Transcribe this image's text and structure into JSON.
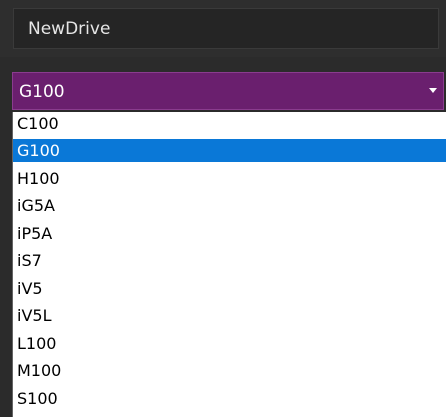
{
  "title_field": {
    "value": "NewDrive"
  },
  "combo": {
    "selected_value": "G100"
  },
  "dropdown": {
    "options": [
      "C100",
      "G100",
      "H100",
      "iG5A",
      "iP5A",
      "iS7",
      "iV5",
      "iV5L",
      "L100",
      "M100",
      "S100"
    ],
    "selected_index": 1
  },
  "colors": {
    "combo_bg": "#6a1f6e",
    "selection_bg": "#0a78d7",
    "panel_bg": "#2b2b2b"
  },
  "icons": {
    "combo_arrow": "chevron-down-icon"
  }
}
